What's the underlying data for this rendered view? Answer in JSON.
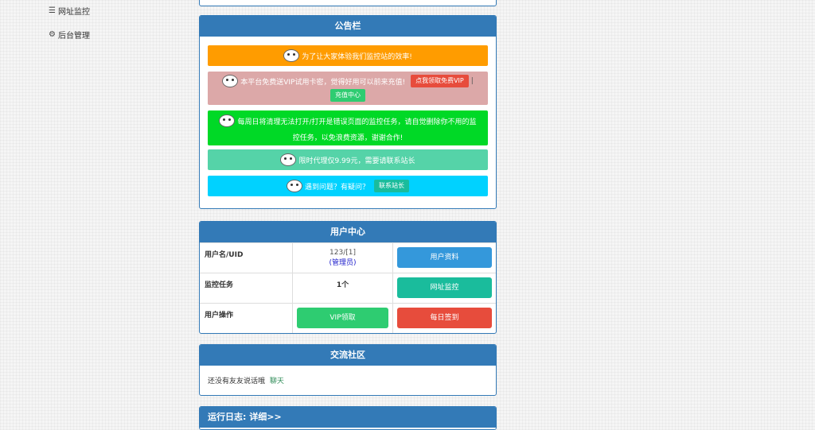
{
  "sidebar": {
    "items": [
      {
        "label": "网址监控",
        "icon": "server-icon"
      },
      {
        "label": "后台管理",
        "icon": "gear-icon"
      }
    ]
  },
  "notice_panel": {
    "title": "公告栏",
    "n1": {
      "text": "为了让大家体验我们监控站的效率!",
      "color": "#ff9c00"
    },
    "n2": {
      "text": "本平台免费送VIP试用卡密，觉得好用可以前来充值!",
      "btn_vip": "点我领取免费VIP",
      "sep": "|",
      "btn_recharge": "充值中心",
      "color": "#dca8a8"
    },
    "n3": {
      "line1": "每周日将清理无法打开/打开是错误页面的监控任务，请自觉删除你不用的监",
      "line2": "控任务，以免浪费资源，谢谢合作!",
      "color": "#00d926"
    },
    "n4": {
      "text": "限时代理仅9.99元，需要请联系站长",
      "color": "#55d3a8"
    },
    "n5": {
      "text": "遇到问题？有疑问？",
      "btn_contact": "联系站长",
      "color": "#00d2ff"
    }
  },
  "user_center": {
    "title": "用户中心",
    "rows": [
      {
        "label": "用户名/UID",
        "value": "123/[1]",
        "sub": "(管理员)",
        "button": "用户资料"
      },
      {
        "label": "监控任务",
        "value": "1个",
        "button": "网址监控"
      },
      {
        "label": "用户操作",
        "button_left": "VIP领取",
        "button": "每日签到"
      }
    ]
  },
  "community": {
    "title": "交流社区",
    "text": "还没有友友说话哦",
    "link": "聊天"
  },
  "log_panel": {
    "title": "运行日志:",
    "link": "详细>>"
  },
  "colors": {
    "primary": "#337ab7",
    "btn_blue": "#3498db",
    "btn_teal": "#1abc9c",
    "btn_green": "#2ecc71",
    "btn_red": "#e74c3c"
  }
}
